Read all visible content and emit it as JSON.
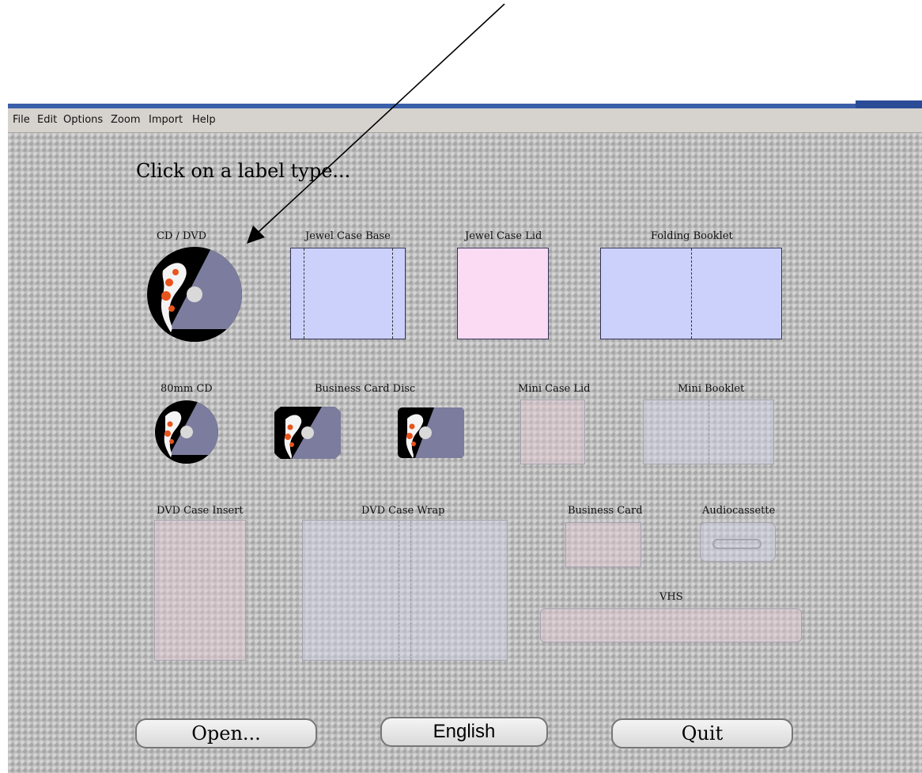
{
  "menu": [
    "File",
    "Edit",
    "Options",
    "Zoom",
    "Import",
    "Help"
  ],
  "heading": "Click on a label type...",
  "labels": {
    "cd_dvd": "CD / DVD",
    "jewel_base": "Jewel Case Base",
    "jewel_lid": "Jewel Case Lid",
    "folding_booklet": "Folding Booklet",
    "cd_80mm": "80mm CD",
    "business_card_disc": "Business Card Disc",
    "mini_case_lid": "Mini Case Lid",
    "mini_booklet": "Mini Booklet",
    "dvd_case_insert": "DVD Case Insert",
    "dvd_case_wrap": "DVD Case Wrap",
    "business_card": "Business Card",
    "audiocassette": "Audiocassette",
    "vhs": "VHS"
  },
  "buttons": {
    "open": "Open...",
    "language": "English",
    "quit": "Quit"
  },
  "colors": {
    "jewel_base": "#ccd1fb",
    "jewel_lid": "#fbdaf3",
    "folding_booklet": "#ccd1fb",
    "disc_dark": "#000000",
    "disc_light": "#7c7c9e",
    "koi_orange": "#e8541c"
  }
}
